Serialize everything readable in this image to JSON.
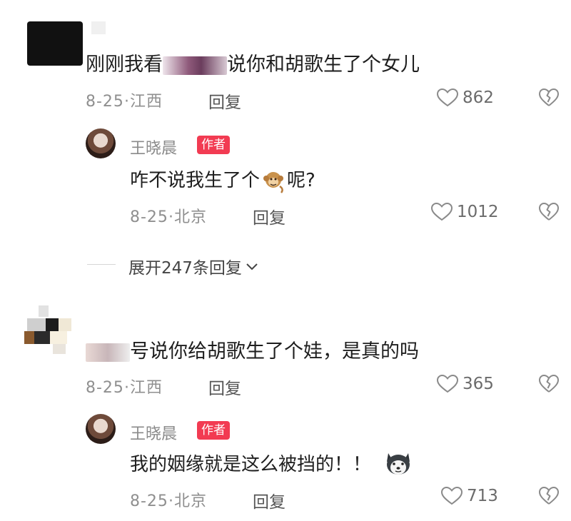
{
  "comments": [
    {
      "text_before": "刚刚我看",
      "text_after": "说你和胡歌生了个女儿",
      "date": "8-25",
      "location": "江西",
      "reply_label": "回复",
      "likes": "862",
      "reply": {
        "username": "王晓晨",
        "badge": "作者",
        "text_before": "咋不说我生了个",
        "emoji": "monkey",
        "text_after": "呢?",
        "date": "8-25",
        "location": "北京",
        "reply_label": "回复",
        "likes": "1012"
      },
      "expand_label": "展开247条回复"
    },
    {
      "text": "号说你给胡歌生了个娃，是真的吗",
      "date": "8-25",
      "location": "江西",
      "reply_label": "回复",
      "likes": "365",
      "reply": {
        "username": "王晓晨",
        "badge": "作者",
        "text": "我的姻缘就是这么被挡的！！",
        "emoji": "husky",
        "date": "8-25",
        "location": "北京",
        "reply_label": "回复",
        "likes": "713"
      }
    }
  ],
  "icons": {
    "like": "heart-outline-icon",
    "dislike": "broken-heart-icon",
    "expand": "chevron-down-icon"
  },
  "colors": {
    "badge": "#f23b52",
    "meta": "#8f8f8f"
  }
}
